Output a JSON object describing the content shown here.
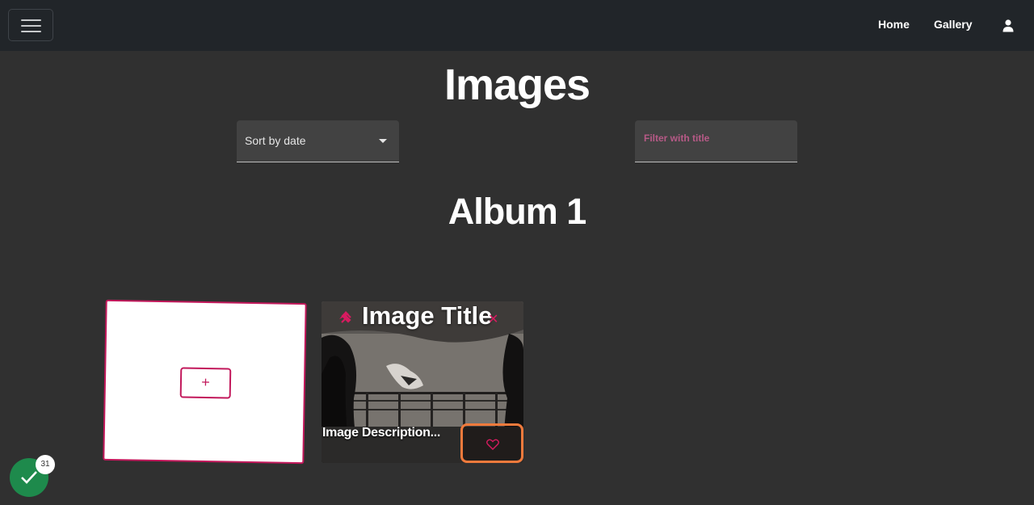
{
  "navbar": {
    "links": [
      "Home",
      "Gallery"
    ],
    "menu_icon": "hamburger-icon",
    "user_icon": "user-icon"
  },
  "page": {
    "title": "Images"
  },
  "controls": {
    "sort_value": "Sort by date",
    "filter_placeholder": "Filter with title"
  },
  "album": {
    "title": "Album 1",
    "add_card": {
      "button_label": "+"
    },
    "image_card": {
      "title": "Image Title",
      "description": "Image Description...",
      "icons": {
        "pin": "pin-icon",
        "close": "close-icon",
        "like": "heart-icon"
      }
    }
  },
  "status": {
    "badge_count": "31",
    "icon": "check-icon",
    "color": "#1e8a4c"
  },
  "colors": {
    "accent": "#c2185b",
    "highlight": "#f07a3c",
    "background": "#303030",
    "navbar": "#212529"
  }
}
